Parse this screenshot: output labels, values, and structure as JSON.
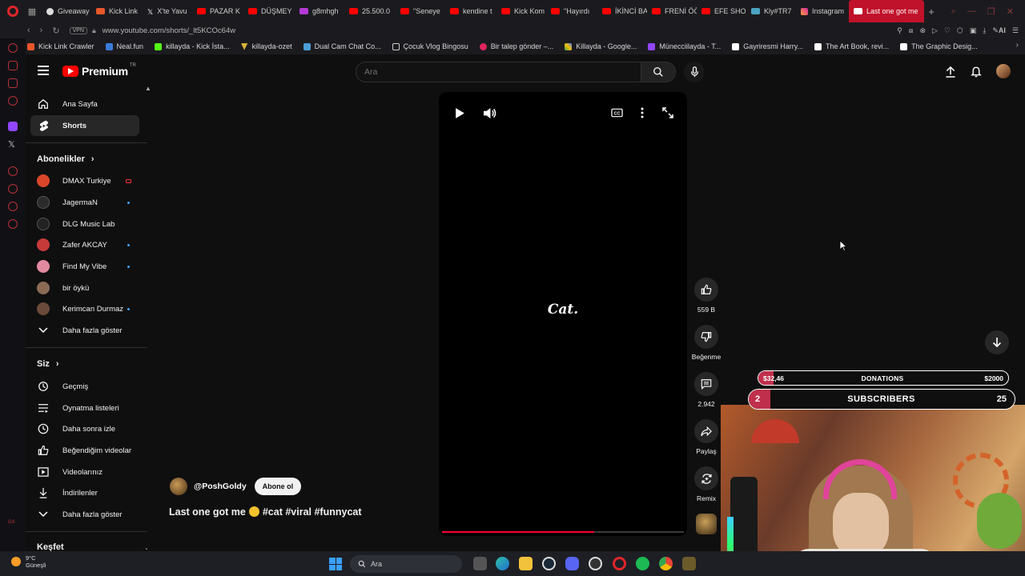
{
  "browser": {
    "tabs": [
      {
        "label": "Giveaway"
      },
      {
        "label": "Kick Link"
      },
      {
        "label": "X'te Yavu"
      },
      {
        "label": "PAZAR K"
      },
      {
        "label": "DÜŞMEY"
      },
      {
        "label": "g8mhgh"
      },
      {
        "label": "25.500.0"
      },
      {
        "label": "\"Seneye"
      },
      {
        "label": "kendine t"
      },
      {
        "label": "Kick Kom"
      },
      {
        "label": "\"Hayırdı"
      },
      {
        "label": "İKİNCİ BA"
      },
      {
        "label": "FRENİ ÖĞ"
      },
      {
        "label": "EFE SHO"
      },
      {
        "label": "Kly#TR7"
      },
      {
        "label": "Instagram"
      }
    ],
    "active_tab": "Last one got me",
    "vpn_label": "VPN",
    "url": "www.youtube.com/shorts/_lt5KCOc64w",
    "ai_label": "AI",
    "bookmarks": [
      "Kick Link Crawler",
      "Neal.fun",
      "killayda - Kick İsta...",
      "killayda-ozet",
      "Dual Cam Chat Co...",
      "Çocuk Vlog Bingosu",
      "Bir talep gönder –...",
      "Killayda - Google...",
      "Münecciilayda - T...",
      "Gayriresmi Harry...",
      "The Art Book, revi...",
      "The Graphic Desig..."
    ]
  },
  "youtube": {
    "logo_text": "Premium",
    "logo_region": "TR",
    "search_placeholder": "Ara",
    "sidebar": {
      "home": "Ana Sayfa",
      "shorts": "Shorts",
      "subscriptions_header": "Abonelikler",
      "channels": [
        {
          "name": "DMAX Turkiye",
          "indicator": "live"
        },
        {
          "name": "JagermaN",
          "indicator": "dot"
        },
        {
          "name": "DLG Music Lab",
          "indicator": "none"
        },
        {
          "name": "Zafer AKCAY",
          "indicator": "dot"
        },
        {
          "name": "Find My Vibe",
          "indicator": "dot"
        },
        {
          "name": "bir öykü",
          "indicator": "none"
        },
        {
          "name": "Kerimcan Durmaz",
          "indicator": "dot"
        }
      ],
      "show_more": "Daha fazla göster",
      "you_header": "Siz",
      "you_items": [
        "Geçmiş",
        "Oynatma listeleri",
        "Daha sonra izle",
        "Beğendiğim videolar",
        "Videolarınız",
        "İndirilenler"
      ],
      "show_more_2": "Daha fazla göster",
      "explore_header": "Keşfet"
    },
    "short": {
      "caption": "Cat.",
      "progress": 0.63,
      "channel": "@PoshGoldy",
      "subscribe_label": "Abone ol",
      "title_before": "Last one got me",
      "title_after": "#cat #viral #funnycat"
    },
    "actions": {
      "likes": "559 B",
      "dislike": "Beğenme",
      "comments": "2.942",
      "share": "Paylaş",
      "remix": "Remix"
    }
  },
  "overlay": {
    "donation_current": "$32,46",
    "donation_label": "DONATIONS",
    "donation_goal": "$2000",
    "donation_fraction": 0.016,
    "subs_current": "2",
    "subs_label": "SUBSCRIBERS",
    "subs_goal": "25",
    "subs_fraction": 0.08
  },
  "taskbar": {
    "temperature": "9°C",
    "weather": "Güneşli",
    "search": "Ara"
  },
  "colors": {
    "yt_red": "#ff0000",
    "progress_red": "#ff0033",
    "overlay_fill": "#c0304c",
    "active_tab": "#c0122a"
  }
}
